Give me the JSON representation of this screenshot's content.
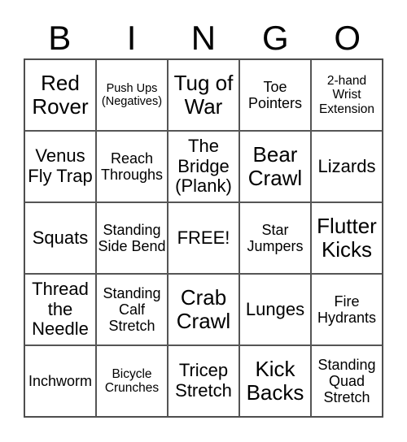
{
  "header": {
    "letters": [
      "B",
      "I",
      "N",
      "G",
      "O"
    ]
  },
  "grid": {
    "rows": [
      [
        {
          "text": "Red Rover",
          "size": "l"
        },
        {
          "text": "Push Ups (Negatives)",
          "size": "xxs"
        },
        {
          "text": "Tug of War",
          "size": "l"
        },
        {
          "text": "Toe Pointers",
          "size": "s"
        },
        {
          "text": "2-hand Wrist Extension",
          "size": "xs"
        }
      ],
      [
        {
          "text": "Venus Fly Trap",
          "size": "m"
        },
        {
          "text": "Reach Throughs",
          "size": "s"
        },
        {
          "text": "The Bridge (Plank)",
          "size": "m"
        },
        {
          "text": "Bear Crawl",
          "size": "l"
        },
        {
          "text": "Lizards",
          "size": "m"
        }
      ],
      [
        {
          "text": "Squats",
          "size": "m"
        },
        {
          "text": "Standing Side Bend",
          "size": "s"
        },
        {
          "text": "FREE!",
          "size": "m"
        },
        {
          "text": "Star Jumpers",
          "size": "s"
        },
        {
          "text": "Flutter Kicks",
          "size": "l"
        }
      ],
      [
        {
          "text": "Thread the Needle",
          "size": "m"
        },
        {
          "text": "Standing Calf Stretch",
          "size": "s"
        },
        {
          "text": "Crab Crawl",
          "size": "l"
        },
        {
          "text": "Lunges",
          "size": "m"
        },
        {
          "text": "Fire Hydrants",
          "size": "s"
        }
      ],
      [
        {
          "text": "Inchworm",
          "size": "s"
        },
        {
          "text": "Bicycle Crunches",
          "size": "xs"
        },
        {
          "text": "Tricep Stretch",
          "size": "m"
        },
        {
          "text": "Kick Backs",
          "size": "l"
        },
        {
          "text": "Standing Quad Stretch",
          "size": "s"
        }
      ]
    ]
  }
}
